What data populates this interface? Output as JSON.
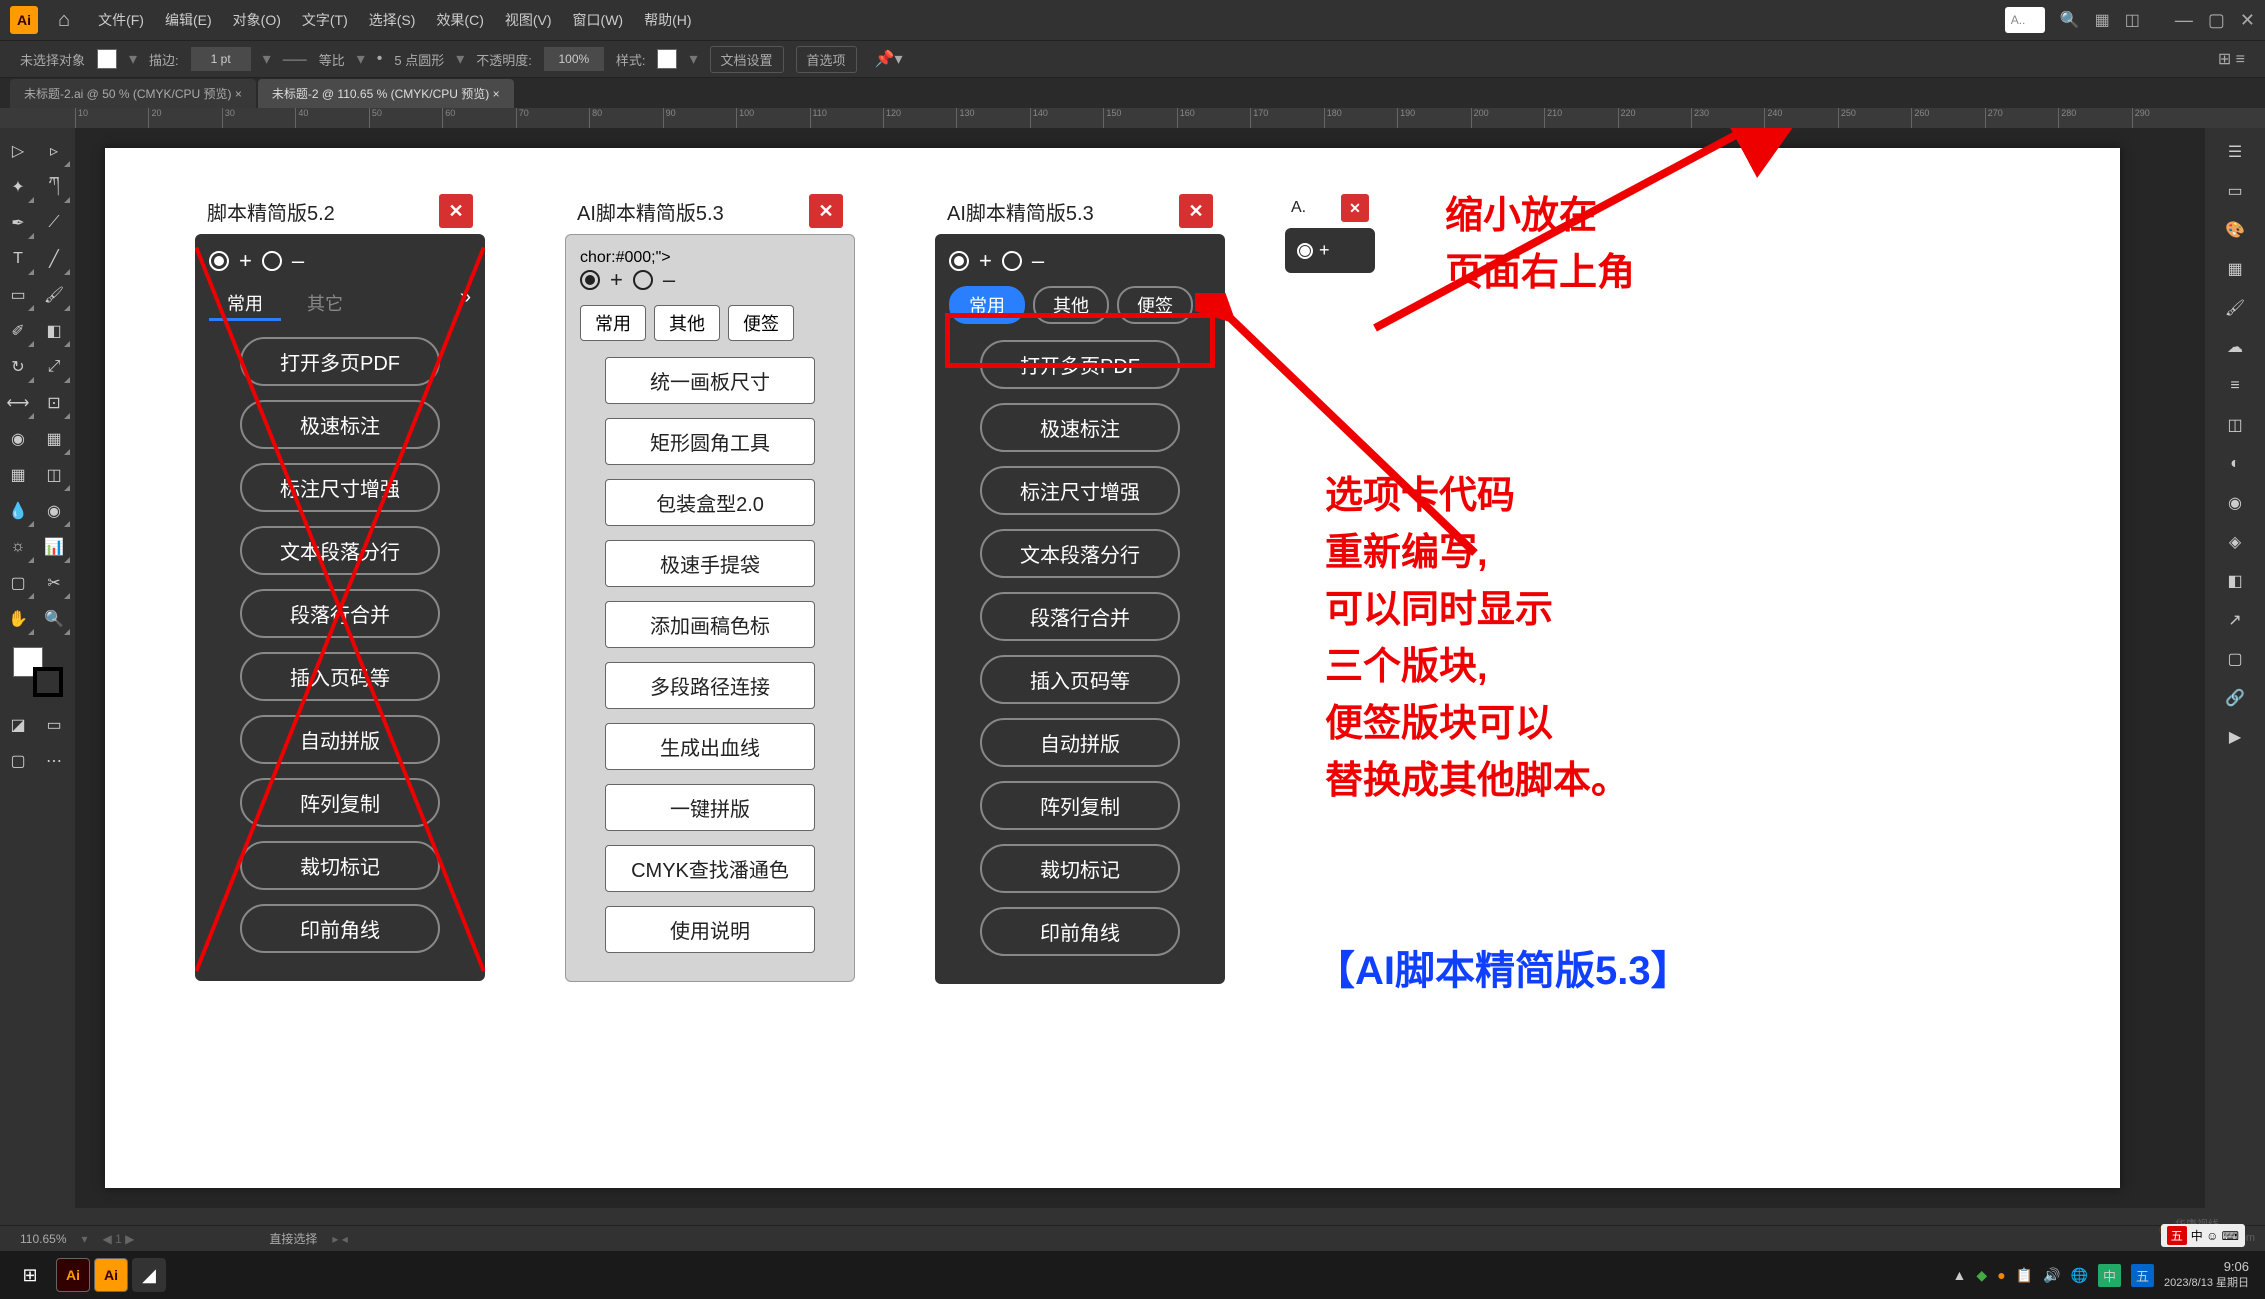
{
  "menubar": {
    "logo": "Ai",
    "items": [
      "文件(F)",
      "编辑(E)",
      "对象(O)",
      "文字(T)",
      "选择(S)",
      "效果(C)",
      "视图(V)",
      "窗口(W)",
      "帮助(H)"
    ],
    "search_short": "A..",
    "search_icon": "🔍"
  },
  "optionsbar": {
    "no_selection": "未选择对象",
    "stroke_label": "描边:",
    "stroke_value": "1 pt",
    "uniform": "等比",
    "points": "5 点圆形",
    "opacity_label": "不透明度:",
    "opacity_value": "100%",
    "style_label": "样式:",
    "doc_setup": "文档设置",
    "prefs": "首选项"
  },
  "tabs": {
    "tab1": "未标题-2.ai @ 50 % (CMYK/CPU 预览)",
    "tab2": "未标题-2 @ 110.65 % (CMYK/CPU 预览)"
  },
  "ruler_values": [
    "10",
    "20",
    "30",
    "40",
    "50",
    "60",
    "70",
    "80",
    "90",
    "100",
    "110",
    "120",
    "130",
    "140",
    "150",
    "160",
    "170",
    "180",
    "190",
    "200",
    "210",
    "220",
    "230",
    "240",
    "250",
    "260",
    "270",
    "280",
    "290"
  ],
  "panel52": {
    "title": "脚本精简版5.2",
    "tabs": [
      "常用",
      "其它"
    ],
    "buttons": [
      "打开多页PDF",
      "极速标注",
      "标注尺寸增强",
      "文本段落分行",
      "段落行合并",
      "插入页码等",
      "自动拼版",
      "阵列复制",
      "裁切标记",
      "印前角线"
    ]
  },
  "panel53_light": {
    "title": "AI脚本精简版5.3",
    "tabs": [
      "常用",
      "其他",
      "便签"
    ],
    "buttons": [
      "统一画板尺寸",
      "矩形圆角工具",
      "包装盒型2.0",
      "极速手提袋",
      "添加画稿色标",
      "多段路径连接",
      "生成出血线",
      "一键拼版",
      "CMYK查找潘通色",
      "使用说明"
    ]
  },
  "panel53_dark": {
    "title": "AI脚本精简版5.3",
    "tabs": [
      "常用",
      "其他",
      "便签"
    ],
    "buttons": [
      "打开多页PDF",
      "极速标注",
      "标注尺寸增强",
      "文本段落分行",
      "段落行合并",
      "插入页码等",
      "自动拼版",
      "阵列复制",
      "裁切标记",
      "印前角线"
    ]
  },
  "panel_mini": {
    "title": "A."
  },
  "annotations": {
    "top": "缩小放在\n页面右上角",
    "mid": "选项卡代码\n重新编写,\n可以同时显示\n三个版块,\n便签版块可以\n替换成其他脚本。",
    "blue": "【AI脚本精简版5.3】"
  },
  "statusbar": {
    "zoom": "110.65%",
    "tool": "直接选择"
  },
  "taskbar": {
    "time": "9:06",
    "date": "2023/8/13 星期日",
    "ime": "五",
    "ime2": "中",
    "lang_indicator": "中 ☺ ⌨"
  },
  "watermark": "华康视线\nwww.52cnp.com"
}
